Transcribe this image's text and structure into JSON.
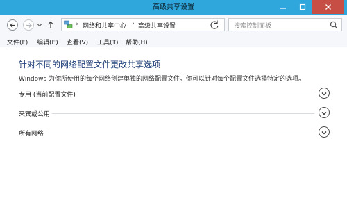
{
  "window": {
    "title": "高级共享设置",
    "controls": {
      "minimize": "minimize-icon",
      "maximize": "maximize-icon",
      "close": "close-icon"
    }
  },
  "address_bar": {
    "prefix": "«",
    "breadcrumbs": [
      "网络和共享中心",
      "高级共享设置"
    ],
    "separator": "›",
    "search_placeholder": "搜索控制面板"
  },
  "menu": {
    "items": [
      "文件(F)",
      "编辑(E)",
      "查看(V)",
      "工具(T)",
      "帮助(H)"
    ]
  },
  "main": {
    "heading": "针对不同的网络配置文件更改共享选项",
    "description": "Windows 为你所使用的每个网络创建单独的网络配置文件。你可以针对每个配置文件选择特定的选项。",
    "sections": [
      {
        "label": "专用 (当前配置文件)"
      },
      {
        "label": "来宾或公用"
      },
      {
        "label": "所有网络"
      }
    ]
  },
  "colors": {
    "titlebar": "#2fa7dc",
    "close_button": "#c74e45",
    "heading": "#1f3f7a"
  }
}
